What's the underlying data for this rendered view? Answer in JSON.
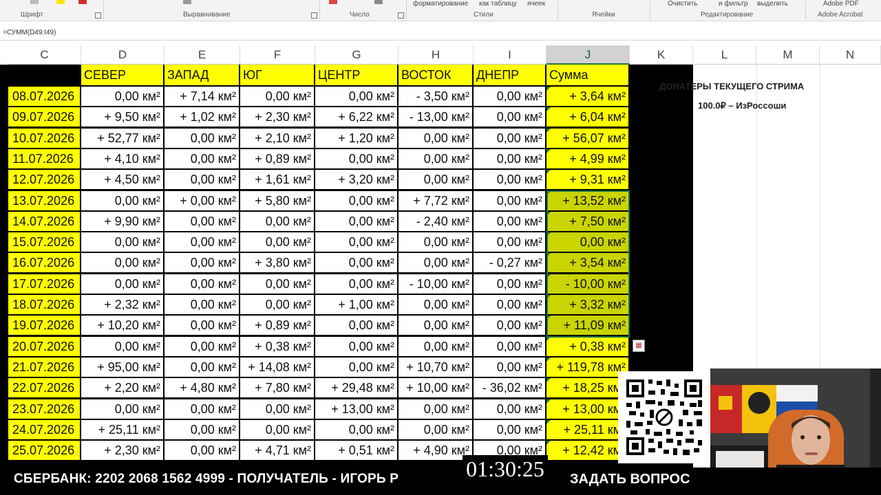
{
  "ribbon": {
    "groups": [
      "Шрифт",
      "Выравнивание",
      "Число",
      "Стили",
      "Ячейки",
      "Редактирование",
      "Adobe Acrobat"
    ],
    "items": [
      "форматирование",
      "как таблицу",
      "ячеек",
      "Очистить",
      "и фильтр",
      "выделить",
      "Adobe PDF"
    ]
  },
  "formula": "=СУММ(D49:I49)",
  "columns": [
    "C",
    "D",
    "E",
    "F",
    "G",
    "H",
    "I",
    "J",
    "K",
    "L",
    "M",
    "N"
  ],
  "selected_column": "J",
  "table": {
    "headers": [
      "СЕВЕР",
      "ЗАПАД",
      "ЮГ",
      "ЦЕНТР",
      "ВОСТОК",
      "ДНЕПР",
      "Сумма"
    ],
    "unit": "км²",
    "rows": [
      {
        "date": "08.07.2026",
        "values": [
          "0,00",
          "+ 7,14",
          "0,00",
          "0,00",
          "- 3,50",
          "0,00",
          "+ 3,64"
        ]
      },
      {
        "date": "09.07.2026",
        "values": [
          "+ 9,50",
          "+ 1,02",
          "+ 2,30",
          "+ 6,22",
          "- 13,00",
          "0,00",
          "+ 6,04"
        ]
      },
      {
        "date": "10.07.2026",
        "values": [
          "+ 52,77",
          "0,00",
          "+ 2,10",
          "+ 1,20",
          "0,00",
          "0,00",
          "+ 56,07"
        ]
      },
      {
        "date": "11.07.2026",
        "values": [
          "+ 4,10",
          "0,00",
          "+ 0,89",
          "0,00",
          "0,00",
          "0,00",
          "+ 4,99"
        ]
      },
      {
        "date": "12.07.2026",
        "values": [
          "+ 4,50",
          "0,00",
          "+ 1,61",
          "+ 3,20",
          "0,00",
          "0,00",
          "+ 9,31"
        ]
      },
      {
        "date": "13.07.2026",
        "values": [
          "0,00",
          "+ 0,00",
          "+ 5,80",
          "0,00",
          "+ 7,72",
          "0,00",
          "+ 13,52"
        ]
      },
      {
        "date": "14.07.2026",
        "values": [
          "+ 9,90",
          "0,00",
          "0,00",
          "0,00",
          "- 2,40",
          "0,00",
          "+ 7,50"
        ]
      },
      {
        "date": "15.07.2026",
        "values": [
          "0,00",
          "0,00",
          "0,00",
          "0,00",
          "0,00",
          "0,00",
          "0,00"
        ]
      },
      {
        "date": "16.07.2026",
        "values": [
          "0,00",
          "0,00",
          "+ 3,80",
          "0,00",
          "0,00",
          "- 0,27",
          "+ 3,54"
        ]
      },
      {
        "date": "17.07.2026",
        "values": [
          "0,00",
          "0,00",
          "0,00",
          "0,00",
          "- 10,00",
          "0,00",
          "- 10,00"
        ]
      },
      {
        "date": "18.07.2026",
        "values": [
          "+ 2,32",
          "0,00",
          "0,00",
          "+ 1,00",
          "0,00",
          "0,00",
          "+ 3,32"
        ]
      },
      {
        "date": "19.07.2026",
        "values": [
          "+ 10,20",
          "0,00",
          "+ 0,89",
          "0,00",
          "0,00",
          "0,00",
          "+ 11,09"
        ]
      },
      {
        "date": "20.07.2026",
        "values": [
          "0,00",
          "0,00",
          "+ 0,38",
          "0,00",
          "0,00",
          "0,00",
          "+ 0,38"
        ]
      },
      {
        "date": "21.07.2026",
        "values": [
          "+ 95,00",
          "0,00",
          "+ 14,08",
          "0,00",
          "+ 10,70",
          "0,00",
          "+ 119,78"
        ]
      },
      {
        "date": "22.07.2026",
        "values": [
          "+ 2,20",
          "+ 4,80",
          "+ 7,80",
          "+ 29,48",
          "+ 10,00",
          "- 36,02",
          "+ 18,25"
        ]
      },
      {
        "date": "23.07.2026",
        "values": [
          "0,00",
          "0,00",
          "0,00",
          "+ 13,00",
          "0,00",
          "0,00",
          "+ 13,00"
        ]
      },
      {
        "date": "24.07.2026",
        "values": [
          "+ 25,11",
          "0,00",
          "0,00",
          "0,00",
          "0,00",
          "0,00",
          "+ 25,11"
        ]
      },
      {
        "date": "25.07.2026",
        "values": [
          "+ 2,30",
          "0,00",
          "+ 4,71",
          "+ 0,51",
          "+ 4,90",
          "0,00",
          "+ 12,42"
        ]
      }
    ]
  },
  "donators": {
    "title": "ДОНАТЕРЫ ТЕКУЩЕГО СТРИМА",
    "line": "100.0₽ – ИзРоссоши"
  },
  "overlay": {
    "bank": "СБЕРБАНК: 2202 2068 1562 4999 - ПОЛУЧАТЕЛЬ - ИГОРЬ Р",
    "timer": "01:30:25",
    "ask": "ЗАДАТЬ ВОПРОС"
  },
  "colors": {
    "yellow": "#ffff00",
    "selected_sum": "#c9d400",
    "accent": "#217346"
  }
}
